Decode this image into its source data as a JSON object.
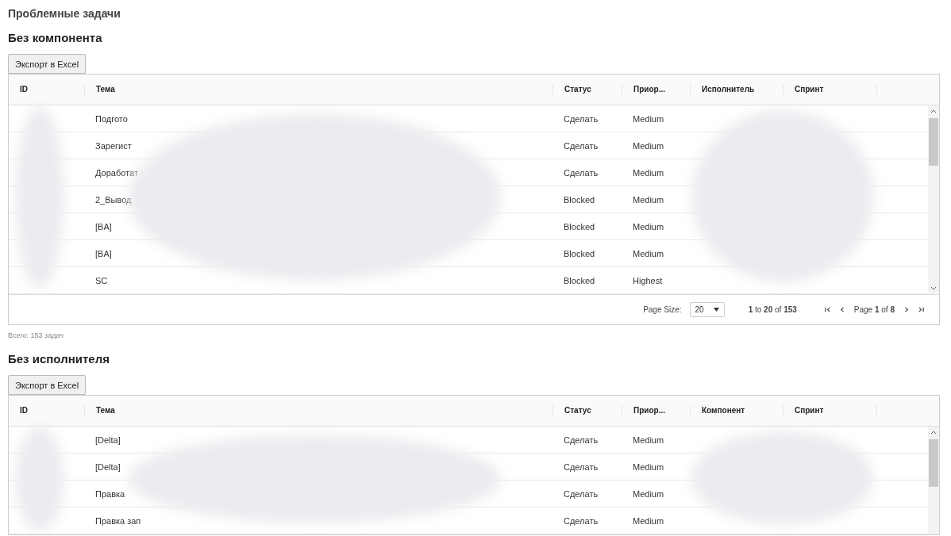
{
  "page_title": "Проблемные задачи",
  "sections": [
    {
      "heading": "Без компонента",
      "export_button": "Экспорт в Excel",
      "columns": [
        "ID",
        "Тема",
        "Статус",
        "Приор...",
        "Исполнитель",
        "Спринт"
      ],
      "rows": [
        {
          "theme": "Подгото",
          "status": "Сделать",
          "priority": "Medium"
        },
        {
          "theme": "Зарегист",
          "status": "Сделать",
          "priority": "Medium"
        },
        {
          "theme": "Доработат",
          "status": "Сделать",
          "priority": "Medium"
        },
        {
          "theme": "2_Вывод",
          "status": "Blocked",
          "priority": "Medium"
        },
        {
          "theme": "[BA]",
          "status": "Blocked",
          "priority": "Medium"
        },
        {
          "theme": "[BA]",
          "status": "Blocked",
          "priority": "Medium"
        },
        {
          "theme": "SC",
          "status": "Blocked",
          "priority": "Highest"
        }
      ],
      "pagination": {
        "page_size_label": "Page Size:",
        "page_size": "20",
        "range": "**1** to **20** of **153**",
        "page": "Page **1** of **8**"
      },
      "total": "Всего: 153 задач"
    },
    {
      "heading": "Без исполнителя",
      "export_button": "Экспорт в Excel",
      "columns": [
        "ID",
        "Тема",
        "Статус",
        "Приор...",
        "Компонент",
        "Спринт"
      ],
      "rows": [
        {
          "theme": "[Delta]",
          "status": "Сделать",
          "priority": "Medium"
        },
        {
          "theme": "[Delta]",
          "status": "Сделать",
          "priority": "Medium"
        },
        {
          "theme": "Правка",
          "status": "Сделать",
          "priority": "Medium"
        },
        {
          "theme": "Правка зап",
          "status": "Сделать",
          "priority": "Medium"
        }
      ]
    }
  ]
}
